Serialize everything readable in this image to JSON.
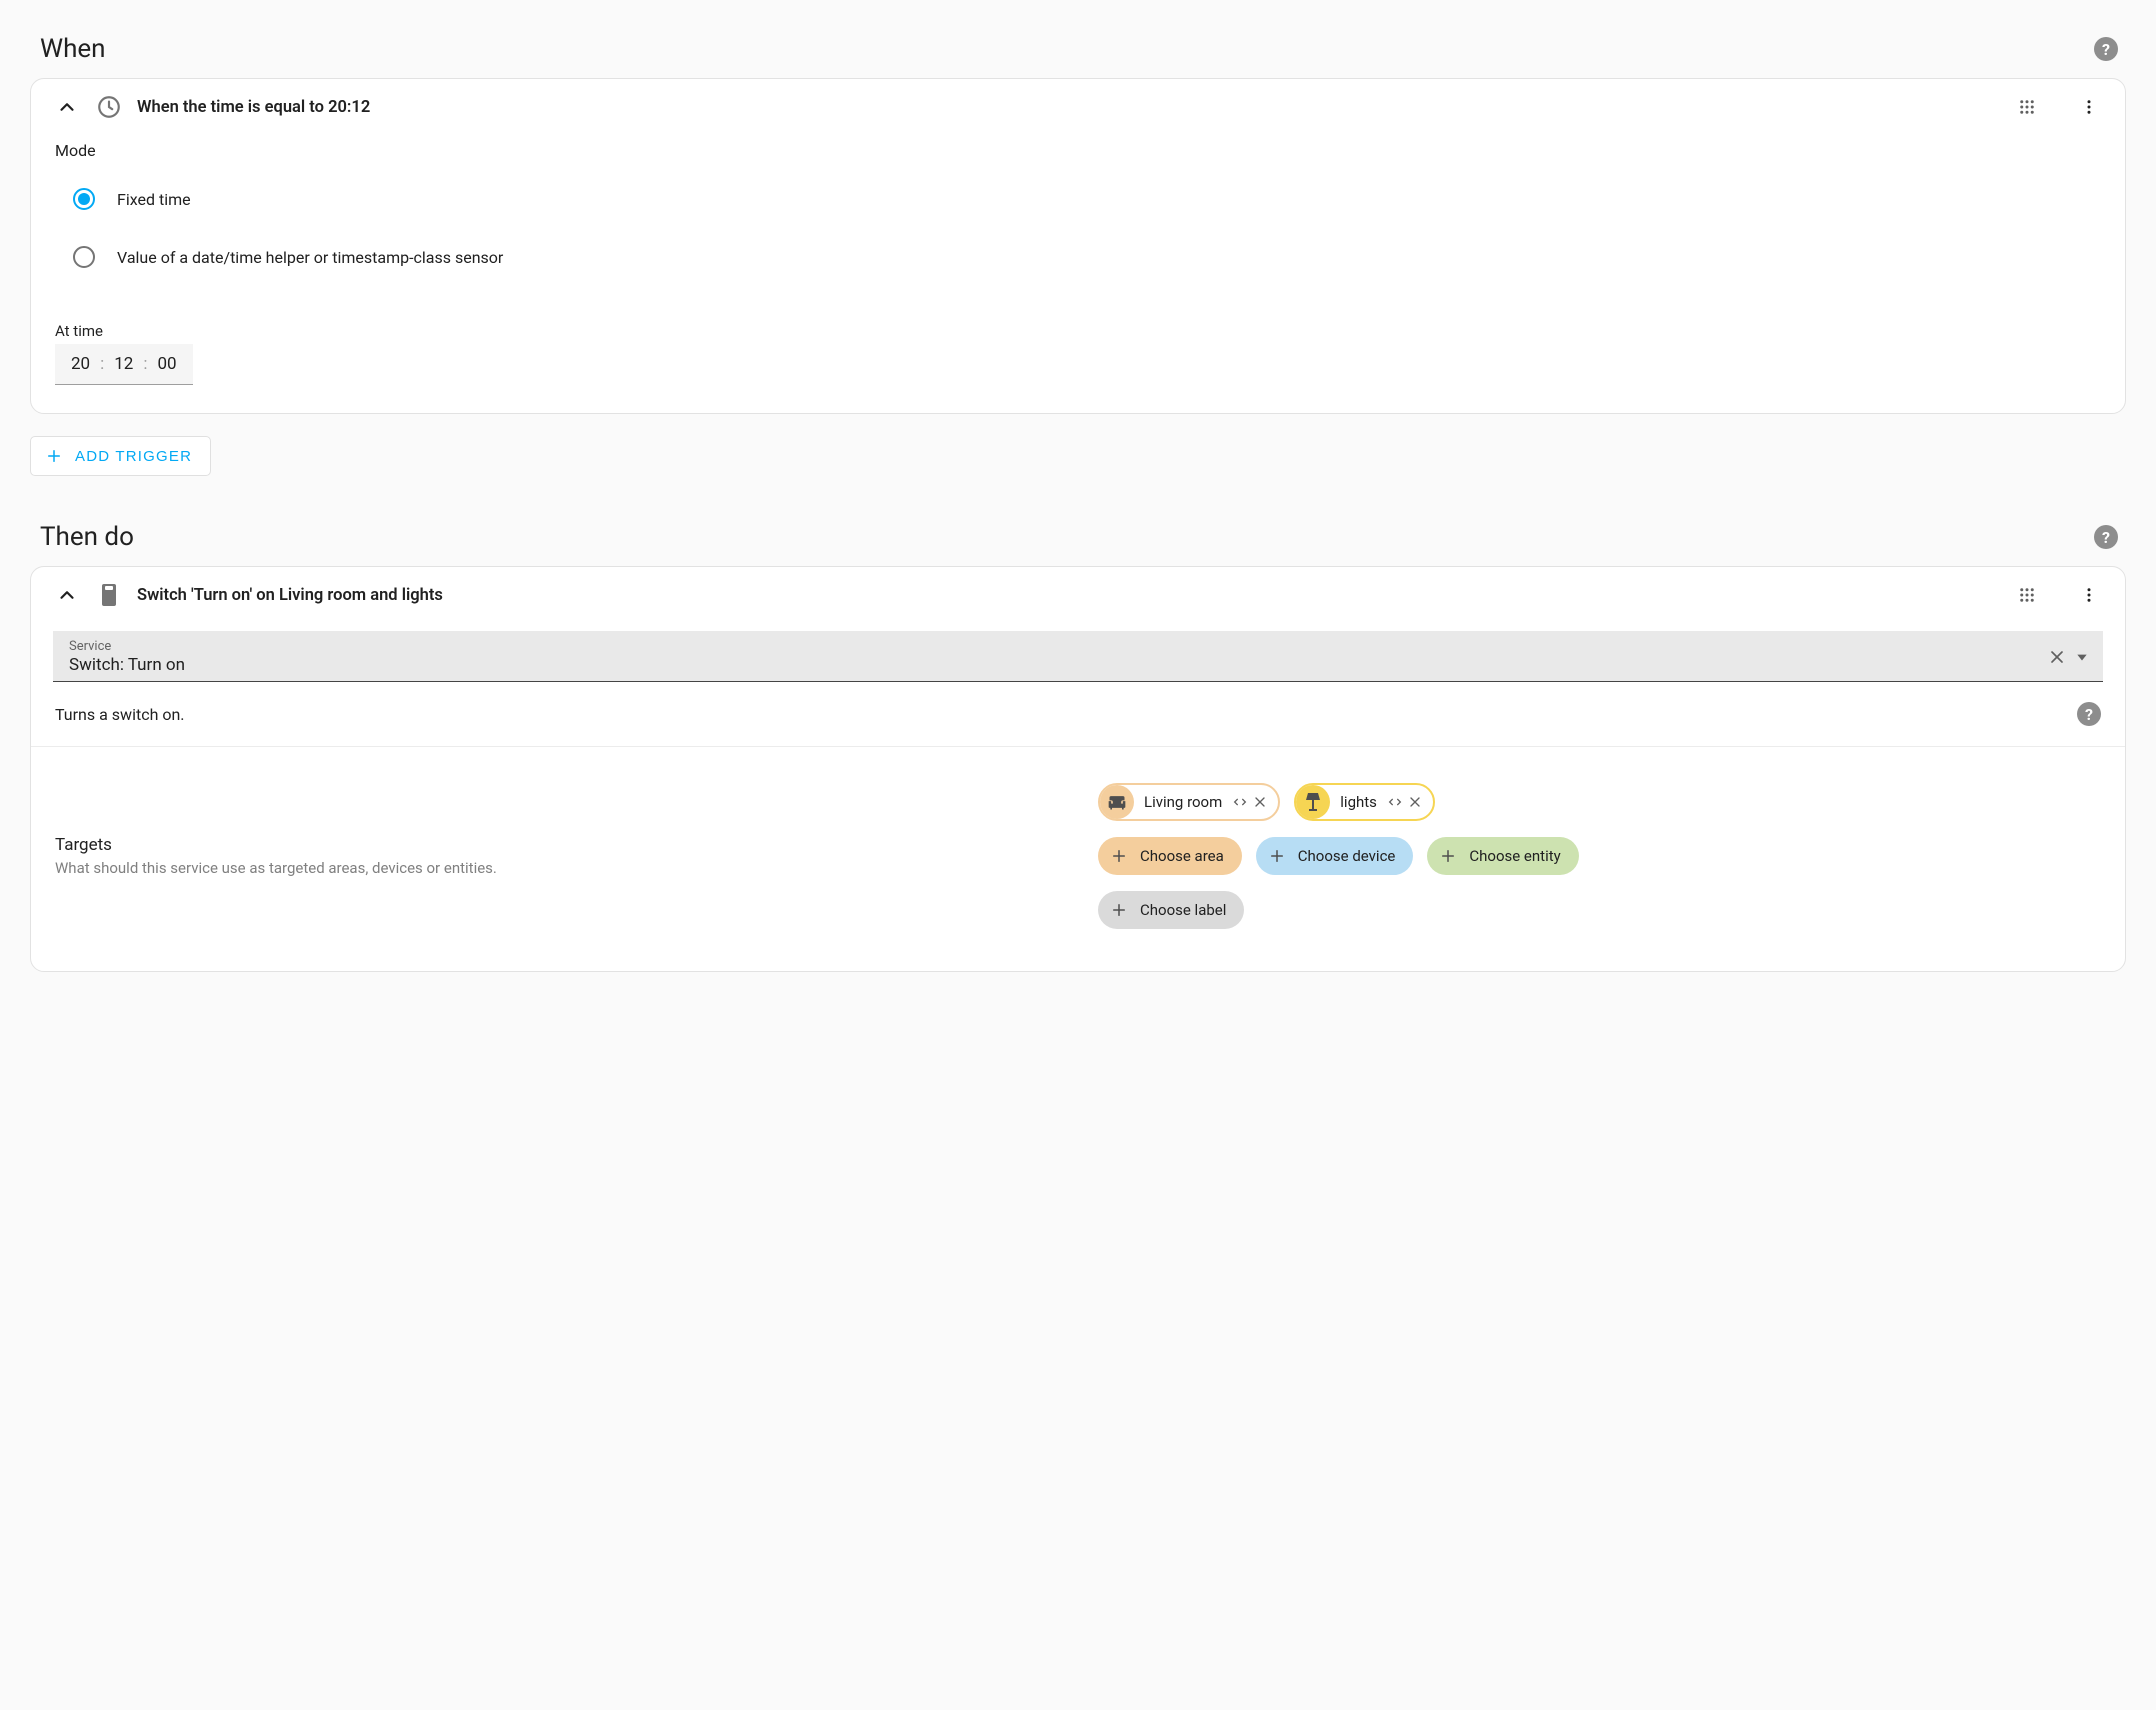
{
  "when": {
    "section_title": "When",
    "trigger": {
      "title": "When the time is equal to 20:12",
      "mode_label": "Mode",
      "options": {
        "fixed": "Fixed time",
        "helper": "Value of a date/time helper or timestamp-class sensor"
      },
      "at_time_label": "At time",
      "time": {
        "hh": "20",
        "mm": "12",
        "ss": "00"
      }
    },
    "add_trigger_label": "ADD TRIGGER"
  },
  "then": {
    "section_title": "Then do",
    "action": {
      "title": "Switch 'Turn on' on Living room and lights",
      "service_label": "Service",
      "service_value": "Switch: Turn on",
      "description": "Turns a switch on.",
      "targets": {
        "title": "Targets",
        "subtitle": "What should this service use as targeted areas, devices or entities.",
        "selected": {
          "area": "Living room",
          "device": "lights"
        },
        "choose": {
          "area": "Choose area",
          "device": "Choose device",
          "entity": "Choose entity",
          "label": "Choose label"
        }
      }
    }
  }
}
